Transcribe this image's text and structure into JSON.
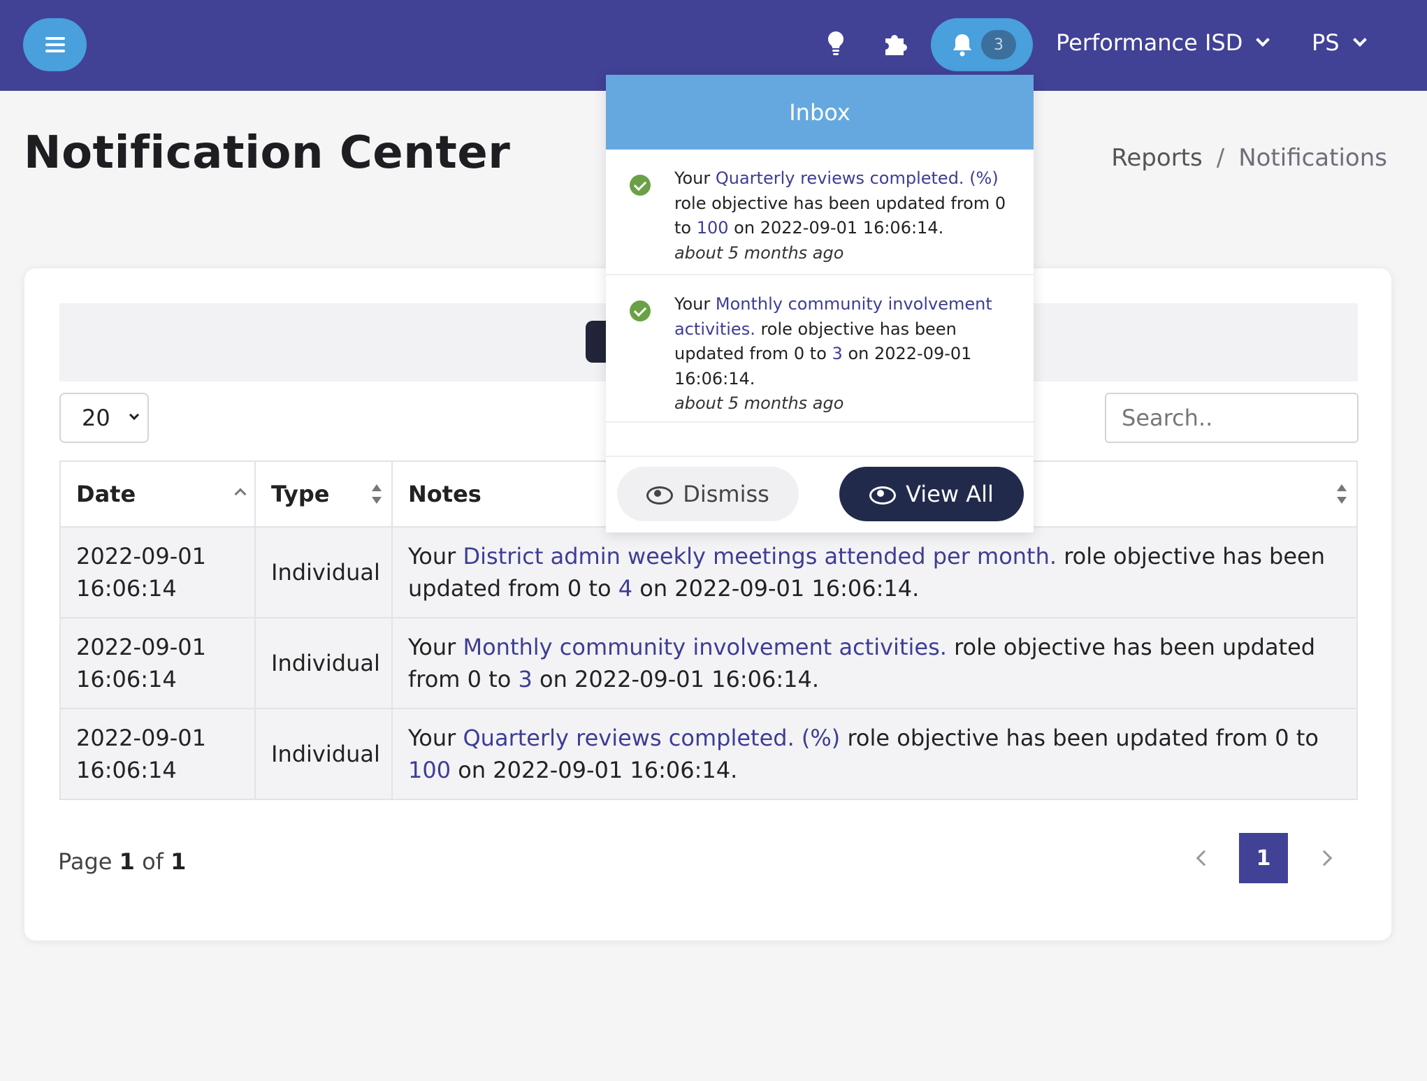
{
  "colors": {
    "topbar": "#414196",
    "accent_blue": "#4a9fdd",
    "inbox_header": "#65a8e0",
    "link": "#3d3d96",
    "check_green": "#6aa046",
    "view_all_bg": "#222a4c"
  },
  "topbar": {
    "menu_icon": "hamburger-icon",
    "icons": [
      "lightbulb-icon",
      "puzzle-icon",
      "bell-icon"
    ],
    "notification_count": "3",
    "org_label": "Performance ISD",
    "user_label": "PS"
  },
  "page": {
    "title": "Notification Center",
    "breadcrumb": [
      "Reports",
      "/",
      "Notifications"
    ]
  },
  "inbox": {
    "title": "Inbox",
    "items": [
      {
        "p1": "Your ",
        "link": "Quarterly reviews completed. (%)",
        "p2": " role objective has been updated from 0 to ",
        "value": "100",
        "p3": " on 2022-09-01 16:06:14.",
        "ago": "about 5 months ago"
      },
      {
        "p1": "Your ",
        "link": "Monthly community involvement activities.",
        "p2": " role objective has been updated from 0 to ",
        "value": "3",
        "p3": " on 2022-09-01 16:06:14.",
        "ago": "about 5 months ago"
      }
    ],
    "dismiss_label": "Dismiss",
    "view_all_label": "View All"
  },
  "table_controls": {
    "page_size": "20",
    "search_placeholder": "Search.."
  },
  "table": {
    "headers": [
      "Date",
      "Type",
      "Notes"
    ],
    "rows": [
      {
        "date": "2022-09-01",
        "time": "16:06:14",
        "type": "Individual",
        "p1": "Your ",
        "link": "District admin weekly meetings attended per month.",
        "p2": " role objective has been updated from 0 to ",
        "value": "4",
        "p3": " on 2022-09-01 16:06:14."
      },
      {
        "date": "2022-09-01",
        "time": "16:06:14",
        "type": "Individual",
        "p1": "Your ",
        "link": "Monthly community involvement activities.",
        "p2": " role objective has been updated from 0 to ",
        "value": "3",
        "p3": " on 2022-09-01 16:06:14."
      },
      {
        "date": "2022-09-01",
        "time": "16:06:14",
        "type": "Individual",
        "p1": "Your ",
        "link": "Quarterly reviews completed. (%)",
        "p2": " role objective has been updated from 0 to ",
        "value": "100",
        "p3": " on 2022-09-01 16:06:14."
      }
    ]
  },
  "pagination": {
    "page_word": "Page ",
    "current": "1",
    "of_word": " of ",
    "total": "1",
    "active_page": "1"
  }
}
